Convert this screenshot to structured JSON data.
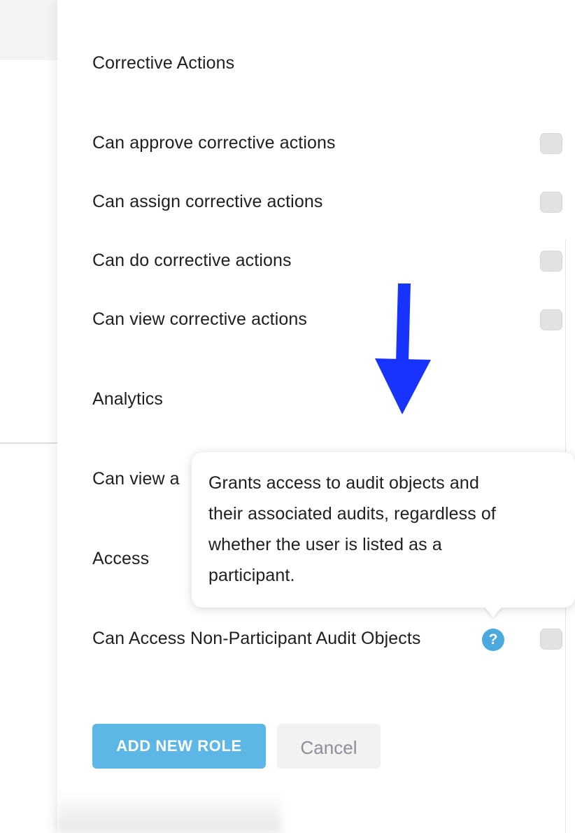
{
  "sections": {
    "corrective_actions": {
      "title": "Corrective Actions",
      "items": [
        {
          "label": "Can approve corrective actions"
        },
        {
          "label": "Can assign corrective actions"
        },
        {
          "label": "Can do corrective actions"
        },
        {
          "label": "Can view corrective actions"
        }
      ]
    },
    "analytics": {
      "title": "Analytics",
      "items": [
        {
          "label": "Can view a"
        }
      ]
    },
    "access": {
      "title": "Access",
      "items": [
        {
          "label": "Can Access Non-Participant Audit Objects",
          "help_icon": "?"
        }
      ]
    }
  },
  "tooltip": {
    "line1": "Grants access to audit objects and",
    "line2": "their associated audits, regardless of",
    "line3": "whether the user is listed as a",
    "line4": "participant."
  },
  "buttons": {
    "primary_label": "ADD NEW ROLE",
    "cancel_label": "Cancel"
  },
  "colors": {
    "primary": "#5cb6e6",
    "help_icon": "#4aa9de",
    "annotation_arrow": "#1933ff",
    "checkbox": "#e2e2e2"
  },
  "icons": {
    "help": "question-circle-icon",
    "annotation": "down-arrow-annotation"
  }
}
